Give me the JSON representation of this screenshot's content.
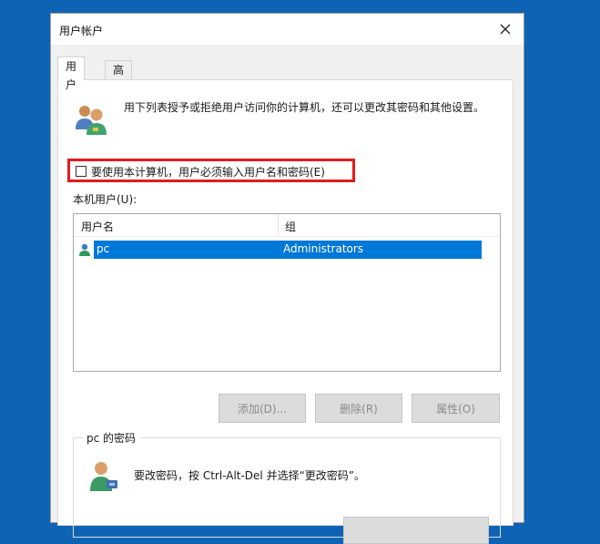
{
  "window": {
    "title": "用户帐户"
  },
  "tabs": [
    {
      "label": "用户",
      "active": true
    },
    {
      "label": "高级",
      "active": false
    }
  ],
  "intro": {
    "text": "用下列表授予或拒绝用户访问你的计算机，还可以更改其密码和其他设置。",
    "icon": "users-icon"
  },
  "require_login": {
    "label": "要使用本计算机，用户必须输入用户名和密码(E)",
    "checked": false
  },
  "users_list": {
    "label": "本机用户(U):",
    "columns": [
      "用户名",
      "组"
    ],
    "rows": [
      {
        "name": "pc",
        "group": "Administrators",
        "selected": true
      }
    ]
  },
  "buttons": {
    "add": "添加(D)...",
    "remove": "删除(R)",
    "properties": "属性(O)"
  },
  "password_group": {
    "title": "pc 的密码",
    "text": "要改密码，按 Ctrl-Alt-Del 并选择“更改密码”。"
  },
  "colors": {
    "selection": "#0078d7",
    "highlight_border": "#e41b1b",
    "desktop": "#0e63b4"
  }
}
